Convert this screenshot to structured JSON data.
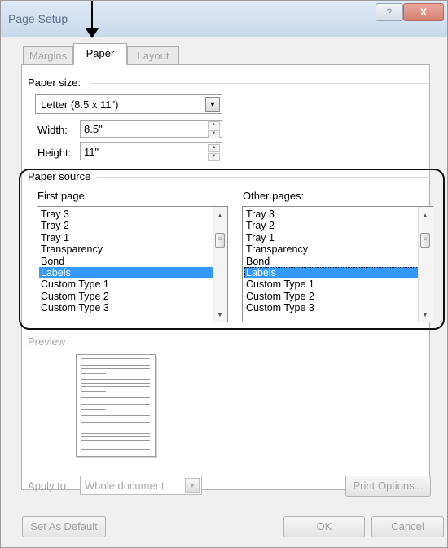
{
  "window": {
    "title": "Page Setup",
    "help_glyph": "?",
    "close_glyph": "X"
  },
  "tabs": [
    {
      "label": "Margins",
      "active": false
    },
    {
      "label": "Paper",
      "active": true
    },
    {
      "label": "Layout",
      "active": false
    }
  ],
  "paper_size": {
    "group_label": "Paper size:",
    "selected": "Letter (8.5 x 11\")",
    "width_label": "Width:",
    "width_value": "8.5\"",
    "height_label": "Height:",
    "height_value": "11\""
  },
  "paper_source": {
    "group_label": "Paper source",
    "first_page_label": "First page:",
    "other_pages_label": "Other pages:",
    "first_page_items": [
      "Tray 3",
      "Tray 2",
      "Tray 1",
      "Transparency",
      "Bond",
      "Labels",
      "Custom Type 1",
      "Custom Type 2",
      "Custom Type 3"
    ],
    "other_pages_items": [
      "Tray 3",
      "Tray 2",
      "Tray 1",
      "Transparency",
      "Bond",
      "Labels",
      "Custom Type 1",
      "Custom Type 2",
      "Custom Type 3"
    ],
    "selected_index": 5
  },
  "preview": {
    "label": "Preview"
  },
  "apply_to": {
    "label": "Apply to:",
    "value": "Whole document"
  },
  "buttons": {
    "print_options": "Print Options...",
    "set_default": "Set As Default",
    "ok": "OK",
    "cancel": "Cancel"
  },
  "icons": {
    "scroll_up": "▲",
    "scroll_down": "▼",
    "scroll_thumb": "≡",
    "dropdown": "▼"
  },
  "colors": {
    "selection": "#3399ff",
    "annotation": "#000000"
  }
}
